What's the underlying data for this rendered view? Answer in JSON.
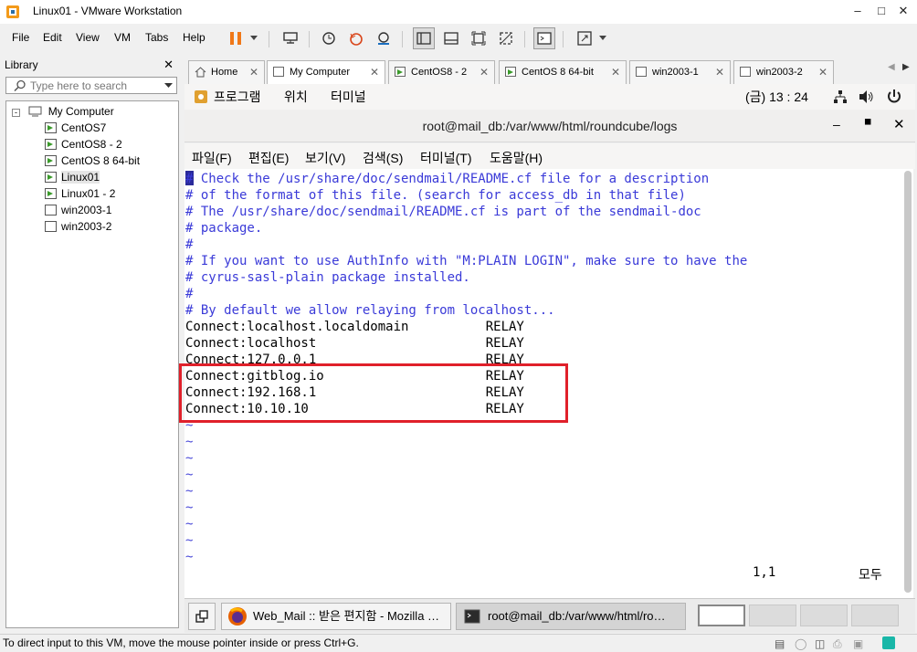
{
  "window": {
    "title": "Linux01 - VMware Workstation"
  },
  "menu": {
    "file": "File",
    "edit": "Edit",
    "view": "View",
    "vm": "VM",
    "tabs": "Tabs",
    "help": "Help"
  },
  "library": {
    "title": "Library",
    "search_placeholder": "Type here to search",
    "root": "My Computer",
    "items": [
      {
        "label": "CentOS7",
        "running": true
      },
      {
        "label": "CentOS8 - 2",
        "running": true
      },
      {
        "label": "CentOS 8 64-bit",
        "running": true
      },
      {
        "label": "Linux01",
        "running": true,
        "selected": true
      },
      {
        "label": "Linux01 - 2",
        "running": true
      },
      {
        "label": "win2003-1",
        "running": false
      },
      {
        "label": "win2003-2",
        "running": false
      }
    ]
  },
  "tabs": [
    {
      "label": "Home"
    },
    {
      "label": "My Computer"
    },
    {
      "label": "CentOS8 - 2"
    },
    {
      "label": "CentOS 8 64-bit"
    },
    {
      "label": "win2003-1"
    },
    {
      "label": "win2003-2"
    }
  ],
  "gnome": {
    "programs": "프로그램",
    "places": "위치",
    "terminal": "터미널",
    "clock": "(금) 13 : 24"
  },
  "terminal": {
    "title": "root@mail_db:/var/www/html/roundcube/logs",
    "menu": {
      "file": "파일(F)",
      "edit": "편집(E)",
      "view": "보기(V)",
      "search": "검색(S)",
      "terminal": "터미널(T)",
      "help": "도움말(H)"
    },
    "lines": [
      {
        "text": "# Check the /usr/share/doc/sendmail/README.cf file for a description",
        "kind": "cmt"
      },
      {
        "text": "# of the format of this file. (search for access_db in that file)",
        "kind": "cmt"
      },
      {
        "text": "# The /usr/share/doc/sendmail/README.cf is part of the sendmail-doc",
        "kind": "cmt"
      },
      {
        "text": "# package.",
        "kind": "cmt"
      },
      {
        "text": "#",
        "kind": "cmt"
      },
      {
        "text": "# If you want to use AuthInfo with \"M:PLAIN LOGIN\", make sure to have the",
        "kind": "cmt"
      },
      {
        "text": "# cyrus-sasl-plain package installed.",
        "kind": "cmt"
      },
      {
        "text": "#",
        "kind": "cmt"
      },
      {
        "text": "# By default we allow relaying from localhost...",
        "kind": "cmt"
      },
      {
        "text": "Connect:localhost.localdomain          RELAY",
        "kind": "txt"
      },
      {
        "text": "Connect:localhost                      RELAY",
        "kind": "txt"
      },
      {
        "text": "Connect:127.0.0.1                      RELAY",
        "kind": "txt"
      },
      {
        "text": "Connect:gitblog.io                     RELAY",
        "kind": "txt"
      },
      {
        "text": "Connect:192.168.1                      RELAY",
        "kind": "txt"
      },
      {
        "text": "Connect:10.10.10                       RELAY",
        "kind": "txt"
      },
      {
        "text": "~",
        "kind": "tilde"
      },
      {
        "text": "~",
        "kind": "tilde"
      },
      {
        "text": "~",
        "kind": "tilde"
      },
      {
        "text": "~",
        "kind": "tilde"
      },
      {
        "text": "~",
        "kind": "tilde"
      },
      {
        "text": "~",
        "kind": "tilde"
      },
      {
        "text": "~",
        "kind": "tilde"
      },
      {
        "text": "~",
        "kind": "tilde"
      },
      {
        "text": "~",
        "kind": "tilde"
      }
    ],
    "cursor_pos": "1,1",
    "scroll_state": "모두"
  },
  "taskbar": {
    "firefox": "Web_Mail :: 받은 편지함 - Mozilla …",
    "terminal": "root@mail_db:/var/www/html/ro…"
  },
  "statusbar": {
    "message": "To direct input to this VM, move the mouse pointer inside or press Ctrl+G."
  },
  "colors": {
    "comment": "#3a3ad8",
    "highlight_box": "#e0202a",
    "run_icon": "#3a9a2a"
  }
}
